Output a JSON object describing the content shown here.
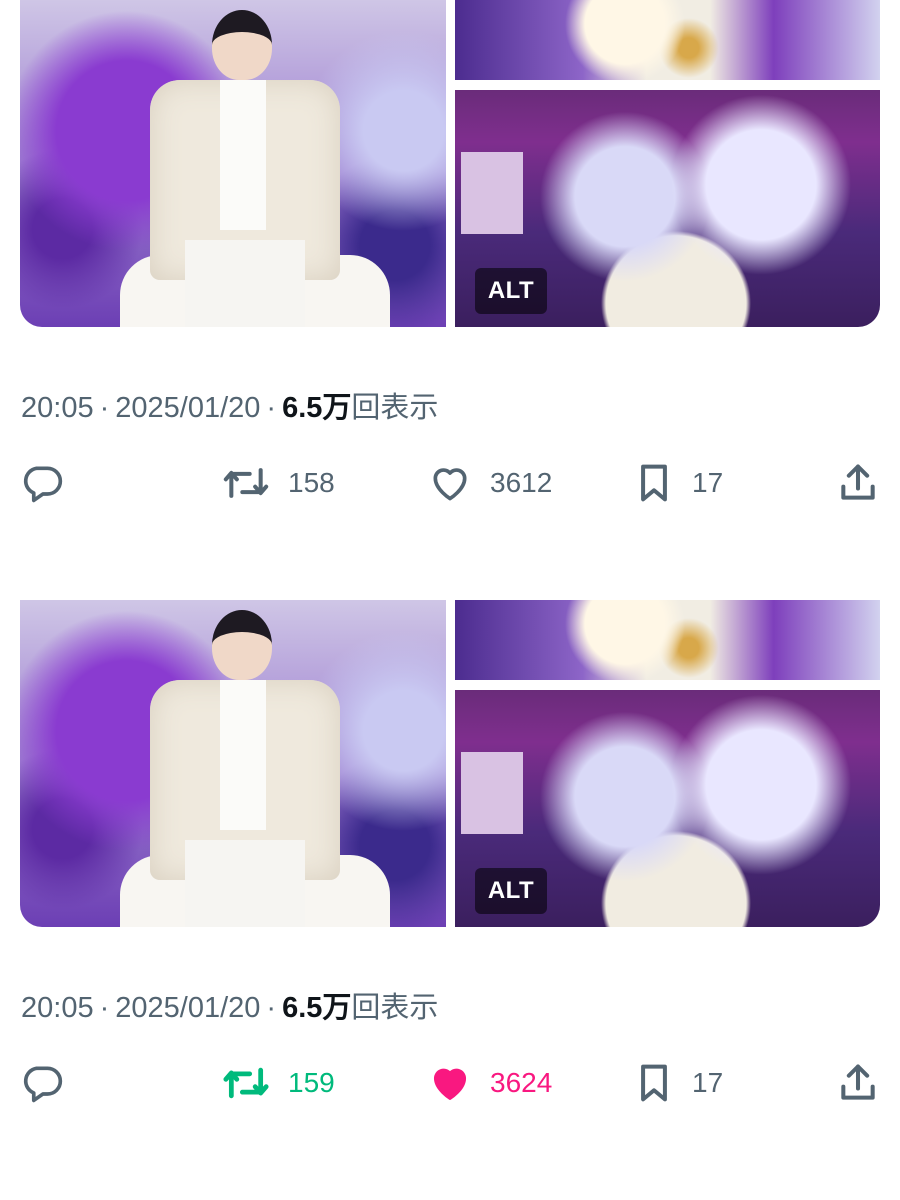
{
  "tweets": [
    {
      "alt_badge": "ALT",
      "time": "20:05",
      "date": "2025/01/20",
      "views_count": "6.5万",
      "views_label": "回表示",
      "retweets": "158",
      "likes": "3612",
      "bookmarks": "17",
      "retweeted": false,
      "liked": false
    },
    {
      "alt_badge": "ALT",
      "time": "20:05",
      "date": "2025/01/20",
      "views_count": "6.5万",
      "views_label": "回表示",
      "retweets": "159",
      "likes": "3624",
      "bookmarks": "17",
      "retweeted": true,
      "liked": true
    }
  ],
  "colors": {
    "text_secondary": "#536471",
    "text_primary": "#0f1419",
    "retweet_active": "#00ba7c",
    "like_active": "#f91880"
  },
  "icons": [
    "reply-icon",
    "retweet-icon",
    "like-icon",
    "bookmark-icon",
    "share-icon"
  ]
}
